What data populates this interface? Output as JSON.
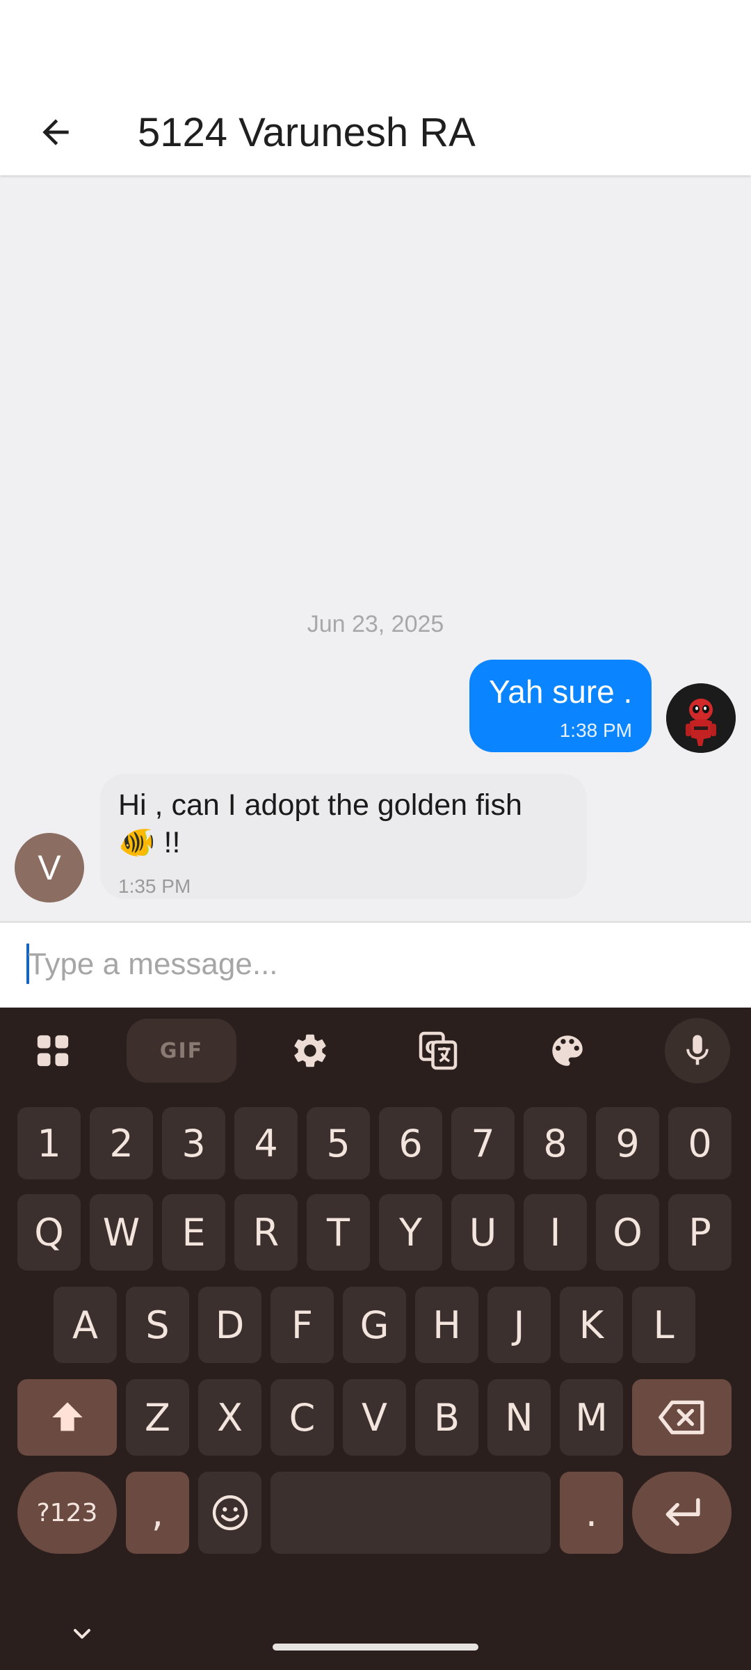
{
  "header": {
    "title": "5124 Varunesh RA"
  },
  "chat": {
    "date_separator": "Jun 23, 2025",
    "messages": [
      {
        "direction": "outgoing",
        "text": "Yah sure .",
        "time": "1:38 PM",
        "avatar": "deadpool-avatar"
      },
      {
        "direction": "incoming",
        "text": "Hi , can I adopt the golden fish",
        "emoji": "🐠",
        "trailing": "!!",
        "time": "1:35 PM",
        "avatar_letter": "V"
      }
    ]
  },
  "composer": {
    "placeholder": "Type a message..."
  },
  "keyboard": {
    "toolbar": {
      "gif_label": "GIF",
      "icons": [
        "apps-grid-icon",
        "settings-gear-icon",
        "translate-icon",
        "palette-icon",
        "microphone-icon"
      ]
    },
    "rows": {
      "numbers": [
        "1",
        "2",
        "3",
        "4",
        "5",
        "6",
        "7",
        "8",
        "9",
        "0"
      ],
      "row1": [
        "Q",
        "W",
        "E",
        "R",
        "T",
        "Y",
        "U",
        "I",
        "O",
        "P"
      ],
      "row2": [
        "A",
        "S",
        "D",
        "F",
        "G",
        "H",
        "J",
        "K",
        "L"
      ],
      "row3": [
        "Z",
        "X",
        "C",
        "V",
        "B",
        "N",
        "M"
      ]
    },
    "bottom": {
      "symbols_label": "?123",
      "comma": ",",
      "period": "."
    }
  },
  "colors": {
    "outgoing_bubble": "#0a84ff",
    "incoming_bubble": "#ebebed",
    "keyboard_bg": "#2a1f1c",
    "avatar_v": "#8c6d62"
  }
}
